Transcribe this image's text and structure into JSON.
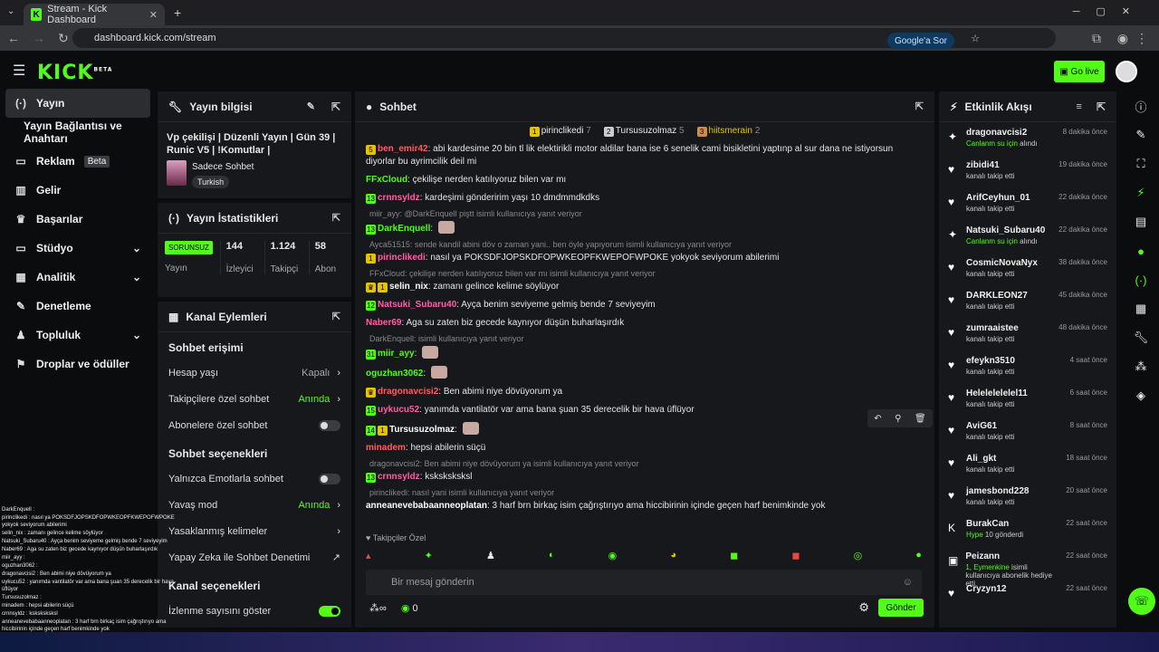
{
  "browser": {
    "tab_title": "Stream - Kick Dashboard",
    "url": "dashboard.kick.com/stream",
    "google_sor": "Google'a Sor"
  },
  "header": {
    "logo": "KICK",
    "logo_sup": "BETA",
    "go_live": "Go live"
  },
  "nav": [
    {
      "label": "Yayın",
      "icon": "(·)"
    },
    {
      "label": "Yayın Bağlantısı ve Anahtarı",
      "icon": ""
    },
    {
      "label": "Reklam",
      "icon": "▭",
      "badge": "Beta"
    },
    {
      "label": "Gelir",
      "icon": "▥"
    },
    {
      "label": "Başarılar",
      "icon": "♛"
    },
    {
      "label": "Stüdyo",
      "icon": "▭",
      "chev": "⌄"
    },
    {
      "label": "Analitik",
      "icon": "▦",
      "chev": "⌄"
    },
    {
      "label": "Denetleme",
      "icon": "✎"
    },
    {
      "label": "Topluluk",
      "icon": "♟",
      "chev": "⌄"
    },
    {
      "label": "Droplar ve ödüller",
      "icon": "⚑"
    }
  ],
  "info": {
    "title": "Yayın bilgisi",
    "stream_title": "Vp çekilişi | Düzenli Yayın | Gün 39 | Runic V5 | !Komutlar |",
    "category": "Sadece Sohbet",
    "tag": "Turkish"
  },
  "stats": {
    "title": "Yayın İstatistikleri",
    "status": "SORUNSUZ",
    "status_label": "Yayın",
    "viewers": "144",
    "viewers_label": "İzleyici",
    "followers": "1.124",
    "followers_label": "Takipçi",
    "subs": "58",
    "subs_label": "Abon"
  },
  "actions": {
    "title": "Kanal Eylemleri",
    "sec1": "Sohbet erişimi",
    "account_age": "Hesap yaşı",
    "account_age_val": "Kapalı",
    "followers_only": "Takipçilere özel sohbet",
    "followers_only_val": "Anında",
    "subs_only": "Abonelere özel sohbet",
    "sec2": "Sohbet seçenekleri",
    "emote_only": "Yalnızca Emotlarla sohbet",
    "slow": "Yavaş mod",
    "slow_val": "Anında",
    "banned": "Yasaklanmış kelimeler",
    "ai": "Yapay Zeka ile Sohbet Denetimi",
    "sec3": "Kanal seçenekleri",
    "viewer_count": "İzlenme sayısını göster"
  },
  "chat": {
    "title": "Sohbet",
    "top1": "pirinclikedi",
    "top1_n": "7",
    "top2": "Tursusuzolmaz",
    "top2_n": "5",
    "top3": "hiitsmerain",
    "top3_n": "2",
    "messages": [
      {
        "reply": "",
        "badges": [
          "5"
        ],
        "user": "ben_emir42",
        "color": "#ff5e5e",
        "text": "abi kardesime 20 bin tl lik elektirikli motor aldilar bana ise 6 senelik cami bisikletini yaptınp al sur dana ne istiyorsun diyorlar bu ayrimcilik deil mi"
      },
      {
        "reply": "",
        "badges": [],
        "user": "FFxCloud",
        "color": "#53fc18",
        "text": "çekilişe nerden katılıyoruz bilen var mı"
      },
      {
        "reply": "",
        "badges": [
          "13"
        ],
        "user": "crnnsyldz",
        "color": "#ff5fa8",
        "text": "kardeşimi gönderirim yaşı 10 dmdmmdkdks"
      },
      {
        "reply": "miir_ayy: @DarkEnquell piştt isimli kullanıcıya yanıt veriyor",
        "badges": [
          "13"
        ],
        "user": "DarkEnquell",
        "color": "#53fc18",
        "text": ""
      },
      {
        "reply": "Ayca51515: sende kandil abini döv o zaman yani.. ben öyle yapıyorum isimli kullanıcıya yanıt veriyor",
        "badges": [
          "1"
        ],
        "user": "pirinclikedi",
        "color": "#ff5fa8",
        "text": "nasıl ya POKSDFJOPSKDFOPWKEOPFKWEPOFWPOKE yokyok seviyorum abilerimi"
      },
      {
        "reply": "FFxCloud: çekilişe nerden katılıyoruz bilen var mı isimli kullanıcıya yanıt veriyor",
        "badges": [
          "♛",
          "1"
        ],
        "user": "selin_nix",
        "color": "#fff",
        "text": "zamanı gelince kelime söylüyor"
      },
      {
        "reply": "",
        "badges": [
          "12"
        ],
        "user": "Natsuki_Subaru40",
        "color": "#ff5fa8",
        "text": "Ayça benim seviyeme gelmiş bende 7 seviyeyim"
      },
      {
        "reply": "",
        "badges": [],
        "user": "Naber69",
        "color": "#ff5fa8",
        "text": "Aga su zaten biz gecede kaynıyor düşün buharlaşırdık"
      },
      {
        "reply": "DarkEnquell: isimli kullanıcıya yanıt veriyor",
        "badges": [
          "31"
        ],
        "user": "miir_ayy",
        "color": "#53fc18",
        "text": ""
      },
      {
        "reply": "",
        "badges": [],
        "user": "oguzhan3062",
        "color": "#53fc18",
        "text": ""
      },
      {
        "reply": "",
        "badges": [
          "♛"
        ],
        "user": "dragonavcisi2",
        "color": "#ff5e5e",
        "text": "Ben abimi niye dövüyorum ya"
      },
      {
        "reply": "",
        "badges": [
          "15"
        ],
        "user": "uykucu52",
        "color": "#ff5fa8",
        "text": "yanımda vantilatör var ama bana şuan 35 derecelik bir hava üflüyor"
      },
      {
        "reply": "",
        "badges": [
          "14",
          "1"
        ],
        "user": "Tursusuzolmaz",
        "color": "#fff",
        "text": ""
      },
      {
        "reply": "",
        "badges": [],
        "user": "minadem",
        "color": "#ff5e5e",
        "text": "hepsi abilerin süçü"
      },
      {
        "reply": "dragonavcisi2: Ben abimi niye dövüyorum ya isimli kullanıcıya yanıt veriyor",
        "badges": [
          "13"
        ],
        "user": "crnnsyldz",
        "color": "#ff5fa8",
        "text": "ksksksksksl"
      },
      {
        "reply": "pirinclikedi: nasıl yani isimli kullanıcıya yanıt veriyor",
        "badges": [],
        "user": "anneanevebabaanneoplatan",
        "color": "#fff",
        "text": "3 harf brn birkaç isim çağrıştırıyo ama hiccibirinin içinde geçen harf benimkinde yok"
      }
    ],
    "followers_only": "Takipçiler Özel",
    "placeholder": "Bir mesaj gönderin",
    "points": "0",
    "send": "Gönder"
  },
  "feed": {
    "title": "Etkinlik Akışı",
    "items": [
      {
        "icon": "✦",
        "name": "dragonavcisi2",
        "sub": "Canlanm su için",
        "sub_suffix": "alındı",
        "time": "8 dakika önce",
        "green": true
      },
      {
        "icon": "♥",
        "name": "zibidi41",
        "sub": "kanalı takip etti",
        "time": "19 dakika önce"
      },
      {
        "icon": "♥",
        "name": "ArifCeyhun_01",
        "sub": "kanalı takip etti",
        "time": "22 dakika önce"
      },
      {
        "icon": "✦",
        "name": "Natsuki_Subaru40",
        "sub": "Canlanm su için",
        "sub_suffix": "alındı",
        "time": "22 dakika önce",
        "green": true
      },
      {
        "icon": "♥",
        "name": "CosmicNovaNyx",
        "sub": "kanalı takip etti",
        "time": "38 dakika önce"
      },
      {
        "icon": "♥",
        "name": "DARKLEON27",
        "sub": "kanalı takip etti",
        "time": "45 dakika önce"
      },
      {
        "icon": "♥",
        "name": "zumraaistee",
        "sub": "kanalı takip etti",
        "time": "48 dakika önce"
      },
      {
        "icon": "♥",
        "name": "efeykn3510",
        "sub": "kanalı takip etti",
        "time": "4 saat önce"
      },
      {
        "icon": "♥",
        "name": "Helelelelelel11",
        "sub": "kanalı takip etti",
        "time": "6 saat önce"
      },
      {
        "icon": "♥",
        "name": "AviG61",
        "sub": "kanalı takip etti",
        "time": "8 saat önce"
      },
      {
        "icon": "♥",
        "name": "Ali_gkt",
        "sub": "kanalı takip etti",
        "time": "18 saat önce"
      },
      {
        "icon": "♥",
        "name": "jamesbond228",
        "sub": "kanalı takip etti",
        "time": "20 saat önce"
      },
      {
        "icon": "K",
        "name": "BurakCan",
        "sub": "Hype",
        "sub_suffix": "10 gönderdi",
        "time": "22 saat önce",
        "green": true
      },
      {
        "icon": "▣",
        "name": "Peizann",
        "sub": "1, Eymenkine",
        "sub_suffix": "isimli kullanıcıya abonelik hediye etti.",
        "time": "22 saat önce",
        "green": true
      },
      {
        "icon": "♥",
        "name": "Cryzyn12",
        "sub": "",
        "time": "22 saat önce"
      }
    ]
  },
  "overlay": [
    "DarkEnquell :",
    "pirinclikedi : nasıl ya POKSDFJOPSKDFOPWKEOPFKWEPOFWPOKE yokyok seviyorum abilerimi",
    "selin_nix : zamanı gelince kelime söylüyor",
    "Natsuki_Subaru40 : Ayça benim seviyeme gelmiş bende 7 seviyeyim",
    "Naber69 : Aga su zaten biz gecede kaynıyor düşün buharlaşırdık",
    "miir_ayy :",
    "oguzhan3062 :",
    "dragonavcisi2 : Ben abimi niye dövüyorum ya",
    "uykucu52 : yanımda vantilatör var ama bana şuan 35 derecelik bir hava üflüyor",
    "Tursusuzolmaz :",
    "minadem : hepsi abilerin süçü",
    "crnnsyldz : ksksksksksl",
    "anneanevebabaanneoplatan : 3 harf brn birkaç isim çağrıştırıyo ama hiccibirinin içinde geçen harf benimkinde yok"
  ],
  "colors": {
    "accent": "#53fc18",
    "panel": "#17181b",
    "bg": "#0b0c0d"
  }
}
